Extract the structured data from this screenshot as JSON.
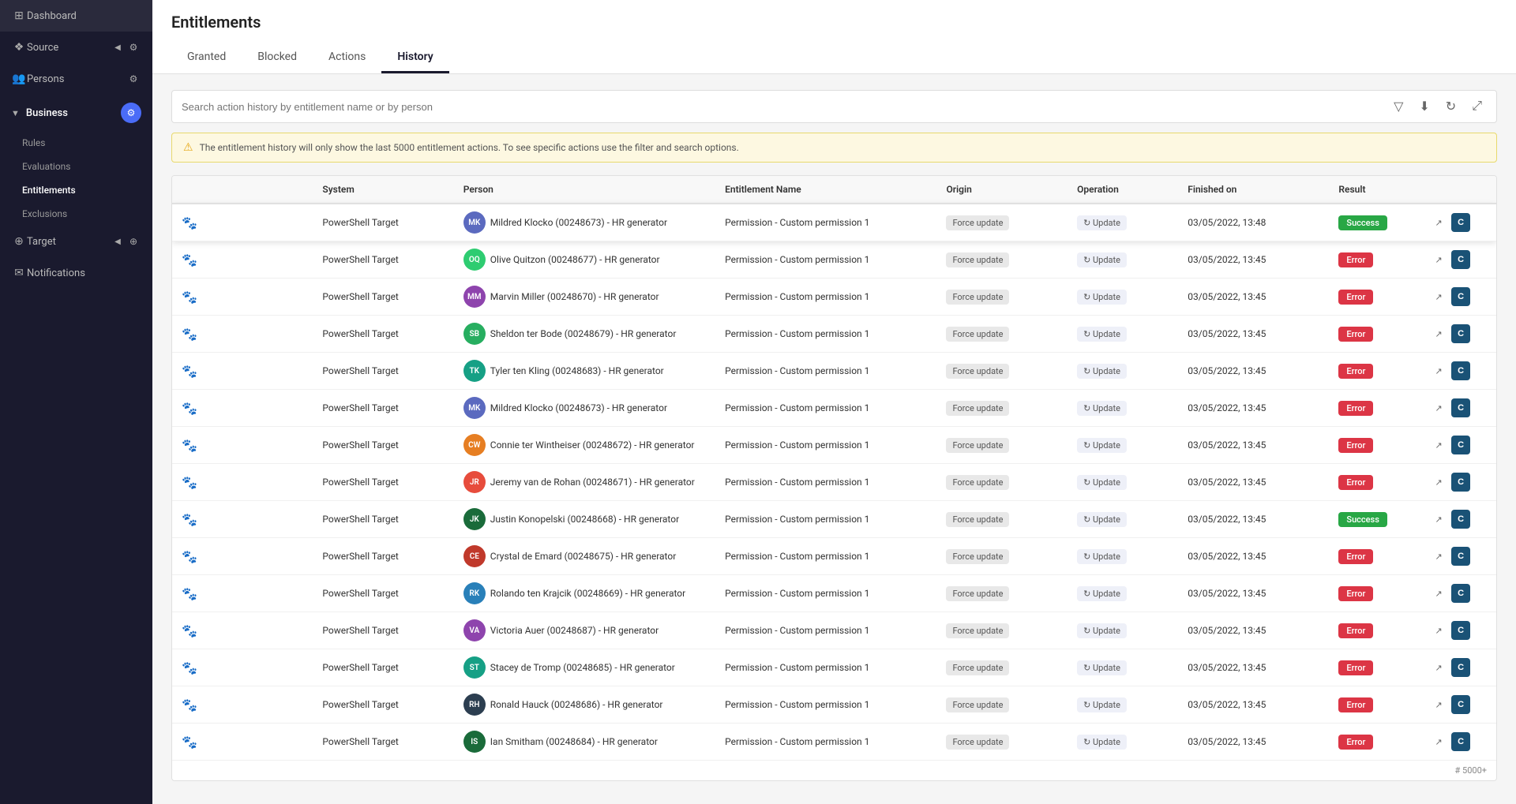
{
  "sidebar": {
    "items": [
      {
        "id": "dashboard",
        "label": "Dashboard",
        "icon": "⊞"
      },
      {
        "id": "source",
        "label": "Source",
        "icon": "◈",
        "hasArrow": true,
        "hasSettings": true
      },
      {
        "id": "persons",
        "label": "Persons",
        "icon": "👥"
      },
      {
        "id": "business",
        "label": "Business",
        "icon": "",
        "hasArrow": true,
        "hasBadge": true
      },
      {
        "id": "rules",
        "label": "Rules",
        "sub": true
      },
      {
        "id": "evaluations",
        "label": "Evaluations",
        "sub": true
      },
      {
        "id": "entitlements",
        "label": "Entitlements",
        "sub": true,
        "active": true
      },
      {
        "id": "exclusions",
        "label": "Exclusions",
        "sub": true
      },
      {
        "id": "target",
        "label": "Target",
        "icon": "⊕",
        "hasArrow": true
      },
      {
        "id": "notifications",
        "label": "Notifications",
        "icon": "✉"
      }
    ]
  },
  "page": {
    "title": "Entitlements",
    "tabs": [
      {
        "id": "granted",
        "label": "Granted"
      },
      {
        "id": "blocked",
        "label": "Blocked"
      },
      {
        "id": "actions",
        "label": "Actions"
      },
      {
        "id": "history",
        "label": "History",
        "active": true
      }
    ]
  },
  "search": {
    "placeholder": "Search action history by entitlement name or by person"
  },
  "warning": {
    "text": "The entitlement history will only show the last 5000 entitlement actions. To see specific actions use the filter and search options."
  },
  "table": {
    "columns": [
      "",
      "System",
      "Person",
      "Entitlement Name",
      "Origin",
      "Operation",
      "Finished on",
      "Result",
      ""
    ],
    "rows": [
      {
        "id": 1,
        "system": "PowerShell Target",
        "avatarColor": "#5b6abf",
        "avatarInitials": "MK",
        "person": "Mildred Klocko (00248673) - HR generator",
        "entitlement": "Permission - Custom permission 1",
        "origin": "Force update",
        "operation": "Update",
        "finished": "03/05/2022, 13:48",
        "result": "Success",
        "highlighted": true
      },
      {
        "id": 2,
        "system": "PowerShell Target",
        "avatarColor": "#2ecc71",
        "avatarInitials": "OQ",
        "person": "Olive Quitzon (00248677) - HR generator",
        "entitlement": "Permission - Custom permission 1",
        "origin": "Force update",
        "operation": "Update",
        "finished": "03/05/2022, 13:45",
        "result": "Error"
      },
      {
        "id": 3,
        "system": "PowerShell Target",
        "avatarColor": "#8e44ad",
        "avatarInitials": "MM",
        "person": "Marvin Miller (00248670) - HR generator",
        "entitlement": "Permission - Custom permission 1",
        "origin": "Force update",
        "operation": "Update",
        "finished": "03/05/2022, 13:45",
        "result": "Error"
      },
      {
        "id": 4,
        "system": "PowerShell Target",
        "avatarColor": "#27ae60",
        "avatarInitials": "SB",
        "person": "Sheldon ter Bode (00248679) - HR generator",
        "entitlement": "Permission - Custom permission 1",
        "origin": "Force update",
        "operation": "Update",
        "finished": "03/05/2022, 13:45",
        "result": "Error"
      },
      {
        "id": 5,
        "system": "PowerShell Target",
        "avatarColor": "#16a085",
        "avatarInitials": "TK",
        "person": "Tyler ten Kling (00248683) - HR generator",
        "entitlement": "Permission - Custom permission 1",
        "origin": "Force update",
        "operation": "Update",
        "finished": "03/05/2022, 13:45",
        "result": "Error"
      },
      {
        "id": 6,
        "system": "PowerShell Target",
        "avatarColor": "#5b6abf",
        "avatarInitials": "MK",
        "person": "Mildred Klocko (00248673) - HR generator",
        "entitlement": "Permission - Custom permission 1",
        "origin": "Force update",
        "operation": "Update",
        "finished": "03/05/2022, 13:45",
        "result": "Error"
      },
      {
        "id": 7,
        "system": "PowerShell Target",
        "avatarColor": "#e67e22",
        "avatarInitials": "CW",
        "person": "Connie ter Wintheiser (00248672) - HR generator",
        "entitlement": "Permission - Custom permission 1",
        "origin": "Force update",
        "operation": "Update",
        "finished": "03/05/2022, 13:45",
        "result": "Error"
      },
      {
        "id": 8,
        "system": "PowerShell Target",
        "avatarColor": "#e74c3c",
        "avatarInitials": "JR",
        "person": "Jeremy van de Rohan (00248671) - HR generator",
        "entitlement": "Permission - Custom permission 1",
        "origin": "Force update",
        "operation": "Update",
        "finished": "03/05/2022, 13:45",
        "result": "Error"
      },
      {
        "id": 9,
        "system": "PowerShell Target",
        "avatarColor": "#1a6b3a",
        "avatarInitials": "JK",
        "person": "Justin Konopelski (00248668) - HR generator",
        "entitlement": "Permission - Custom permission 1",
        "origin": "Force update",
        "operation": "Update",
        "finished": "03/05/2022, 13:45",
        "result": "Success"
      },
      {
        "id": 10,
        "system": "PowerShell Target",
        "avatarColor": "#c0392b",
        "avatarInitials": "CE",
        "person": "Crystal de Emard (00248675) - HR generator",
        "entitlement": "Permission - Custom permission 1",
        "origin": "Force update",
        "operation": "Update",
        "finished": "03/05/2022, 13:45",
        "result": "Error"
      },
      {
        "id": 11,
        "system": "PowerShell Target",
        "avatarColor": "#2980b9",
        "avatarInitials": "RK",
        "person": "Rolando ten Krajcik (00248669) - HR generator",
        "entitlement": "Permission - Custom permission 1",
        "origin": "Force update",
        "operation": "Update",
        "finished": "03/05/2022, 13:45",
        "result": "Error"
      },
      {
        "id": 12,
        "system": "PowerShell Target",
        "avatarColor": "#8e44ad",
        "avatarInitials": "VA",
        "person": "Victoria Auer (00248687) - HR generator",
        "entitlement": "Permission - Custom permission 1",
        "origin": "Force update",
        "operation": "Update",
        "finished": "03/05/2022, 13:45",
        "result": "Error"
      },
      {
        "id": 13,
        "system": "PowerShell Target",
        "avatarColor": "#16a085",
        "avatarInitials": "ST",
        "person": "Stacey de Tromp (00248685) - HR generator",
        "entitlement": "Permission - Custom permission 1",
        "origin": "Force update",
        "operation": "Update",
        "finished": "03/05/2022, 13:45",
        "result": "Error"
      },
      {
        "id": 14,
        "system": "PowerShell Target",
        "avatarColor": "#2c3e50",
        "avatarInitials": "RH",
        "person": "Ronald Hauck (00248686) - HR generator",
        "entitlement": "Permission - Custom permission 1",
        "origin": "Force update",
        "operation": "Update",
        "finished": "03/05/2022, 13:45",
        "result": "Error"
      },
      {
        "id": 15,
        "system": "PowerShell Target",
        "avatarColor": "#1a6b3a",
        "avatarInitials": "IS",
        "person": "Ian Smitham (00248684) - HR generator",
        "entitlement": "Permission - Custom permission 1",
        "origin": "Force update",
        "operation": "Update",
        "finished": "03/05/2022, 13:45",
        "result": "Error"
      }
    ],
    "countBadge": "# 5000+"
  }
}
